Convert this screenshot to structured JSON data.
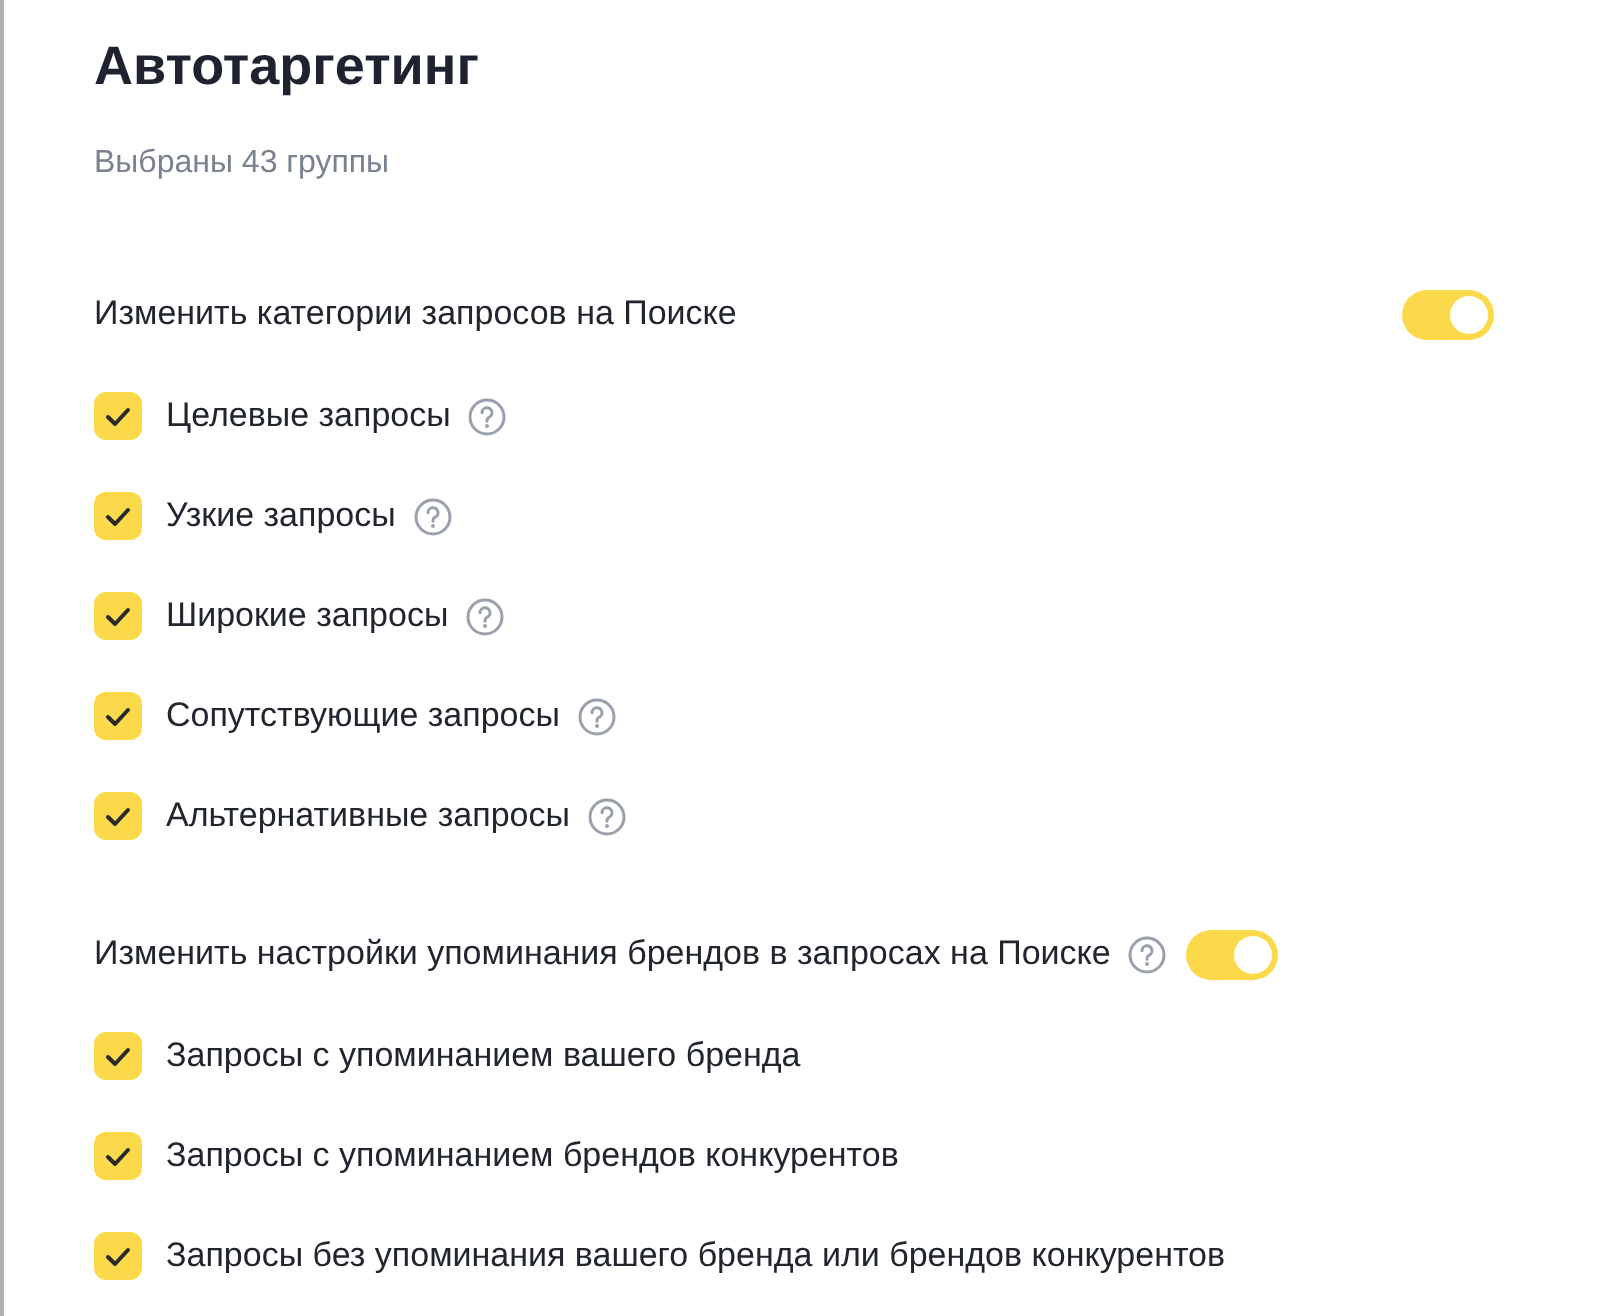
{
  "title": "Автотаргетинг",
  "subtitle": "Выбраны 43 группы",
  "sections": [
    {
      "label": "Изменить категории запросов на Поиске",
      "help": false,
      "on": true,
      "items": [
        {
          "label": "Целевые запросы",
          "checked": true,
          "help": true
        },
        {
          "label": "Узкие запросы",
          "checked": true,
          "help": true
        },
        {
          "label": "Широкие запросы",
          "checked": true,
          "help": true
        },
        {
          "label": "Сопутствующие запросы",
          "checked": true,
          "help": true
        },
        {
          "label": "Альтернативные запросы",
          "checked": true,
          "help": true
        }
      ]
    },
    {
      "label": "Изменить настройки упоминания брендов в запросах на Поиске",
      "help": true,
      "on": true,
      "items": [
        {
          "label": "Запросы с упоминанием вашего бренда",
          "checked": true,
          "help": false
        },
        {
          "label": "Запросы с упоминанием брендов конкурентов",
          "checked": true,
          "help": false
        },
        {
          "label": "Запросы без упоминания вашего бренда или брендов конкурентов",
          "checked": true,
          "help": false
        }
      ]
    }
  ]
}
